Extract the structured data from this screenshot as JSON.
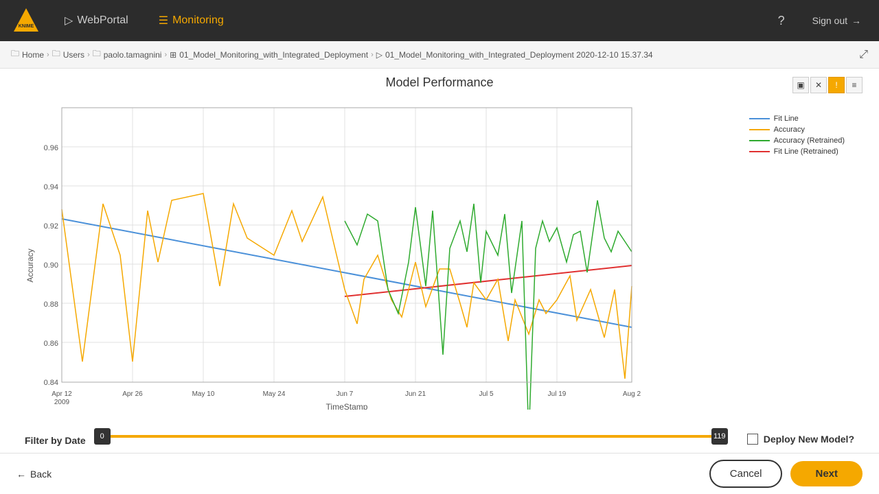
{
  "nav": {
    "webportal_label": "WebPortal",
    "monitoring_label": "Monitoring",
    "help_label": "?",
    "sign_out_label": "Sign out"
  },
  "breadcrumb": {
    "items": [
      {
        "label": "Home",
        "icon": "folder-icon"
      },
      {
        "label": "Users",
        "icon": "folder-icon"
      },
      {
        "label": "paolo.tamagnini",
        "icon": "folder-icon"
      },
      {
        "label": "01_Model_Monitoring_with_Integrated_Deployment",
        "icon": "workflow-icon"
      },
      {
        "label": "01_Model_Monitoring_with_Integrated_Deployment 2020-12-10 15.37.34",
        "icon": "run-icon"
      }
    ]
  },
  "chart": {
    "title": "Model Performance",
    "x_label": "TimeStamp",
    "y_label": "Accuracy",
    "y_ticks": [
      "0.84",
      "0.86",
      "0.88",
      "0.90",
      "0.92",
      "0.94",
      "0.96"
    ],
    "x_ticks": [
      "Apr 12\n2009",
      "Apr 26",
      "May 10",
      "May 24",
      "Jun 7",
      "Jun 21",
      "Jul 5",
      "Jul 19",
      "Aug 2"
    ],
    "legend": [
      {
        "label": "Fit Line",
        "color": "#4a90d9"
      },
      {
        "label": "Accuracy",
        "color": "#f5a800"
      },
      {
        "label": "Accuracy (Retrained)",
        "color": "#2eaa2e"
      },
      {
        "label": "Fit Line (Retrained)",
        "color": "#e03030"
      }
    ]
  },
  "controls": {
    "btn1_label": "▣",
    "btn2_label": "✕",
    "btn3_label": "!",
    "btn4_label": "≡"
  },
  "filter": {
    "label": "Filter by Date",
    "min_val": "0",
    "max_val": "119"
  },
  "deploy": {
    "label": "Deploy New Model?"
  },
  "bottom": {
    "back_label": "Back",
    "cancel_label": "Cancel",
    "next_label": "Next"
  }
}
